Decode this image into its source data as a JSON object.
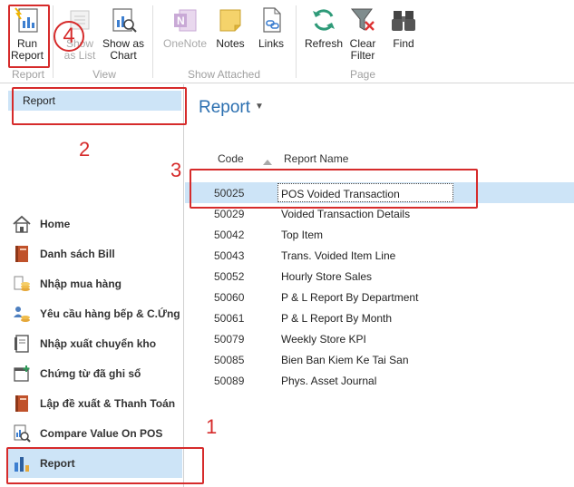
{
  "ribbon": {
    "groups": {
      "report": "Report",
      "view": "View",
      "show_attached": "Show Attached",
      "page": "Page"
    },
    "buttons": {
      "run_report": "Run\nReport",
      "show_as_list": "Show\nas List",
      "show_as_chart": "Show as\nChart",
      "onenote": "OneNote",
      "notes": "Notes",
      "links": "Links",
      "refresh": "Refresh",
      "clear_filter": "Clear\nFilter",
      "find": "Find"
    }
  },
  "nav": {
    "selected_section": "Report",
    "items": [
      {
        "label": "Home",
        "icon": "home-icon"
      },
      {
        "label": "Danh sách Bill",
        "icon": "book-icon"
      },
      {
        "label": "Nhập mua hàng",
        "icon": "coins-icon"
      },
      {
        "label": "Yêu cầu hàng bếp & C.Ứng",
        "icon": "people-coins-icon"
      },
      {
        "label": "Nhập xuất chuyển kho",
        "icon": "ledger-icon"
      },
      {
        "label": "Chứng từ đã ghi sổ",
        "icon": "calendar-add-icon"
      },
      {
        "label": "Lập đề xuất & Thanh Toán",
        "icon": "book-icon"
      },
      {
        "label": "Compare Value On POS",
        "icon": "compare-search-icon"
      },
      {
        "label": "Report",
        "icon": "report-chart-icon"
      }
    ]
  },
  "main": {
    "title": "Report",
    "columns": {
      "code": "Code",
      "name": "Report Name"
    },
    "rows": [
      {
        "code": "50025",
        "name": "POS Voided Transaction"
      },
      {
        "code": "50029",
        "name": "Voided Transaction Details"
      },
      {
        "code": "50042",
        "name": "Top Item"
      },
      {
        "code": "50043",
        "name": "Trans. Voided Item Line"
      },
      {
        "code": "50052",
        "name": "Hourly Store Sales"
      },
      {
        "code": "50060",
        "name": "P & L Report By Department"
      },
      {
        "code": "50061",
        "name": "P & L Report By Month"
      },
      {
        "code": "50079",
        "name": "Weekly Store KPI"
      },
      {
        "code": "50085",
        "name": "Bien Ban Kiem Ke Tai San"
      },
      {
        "code": "50089",
        "name": "Phys. Asset Journal"
      }
    ]
  },
  "annotations": {
    "n1": "1",
    "n2": "2",
    "n3": "3",
    "n4": "4"
  },
  "colors": {
    "accent": "#2b6fb0",
    "selection": "#cde4f7",
    "annotation": "#d62b2b"
  }
}
